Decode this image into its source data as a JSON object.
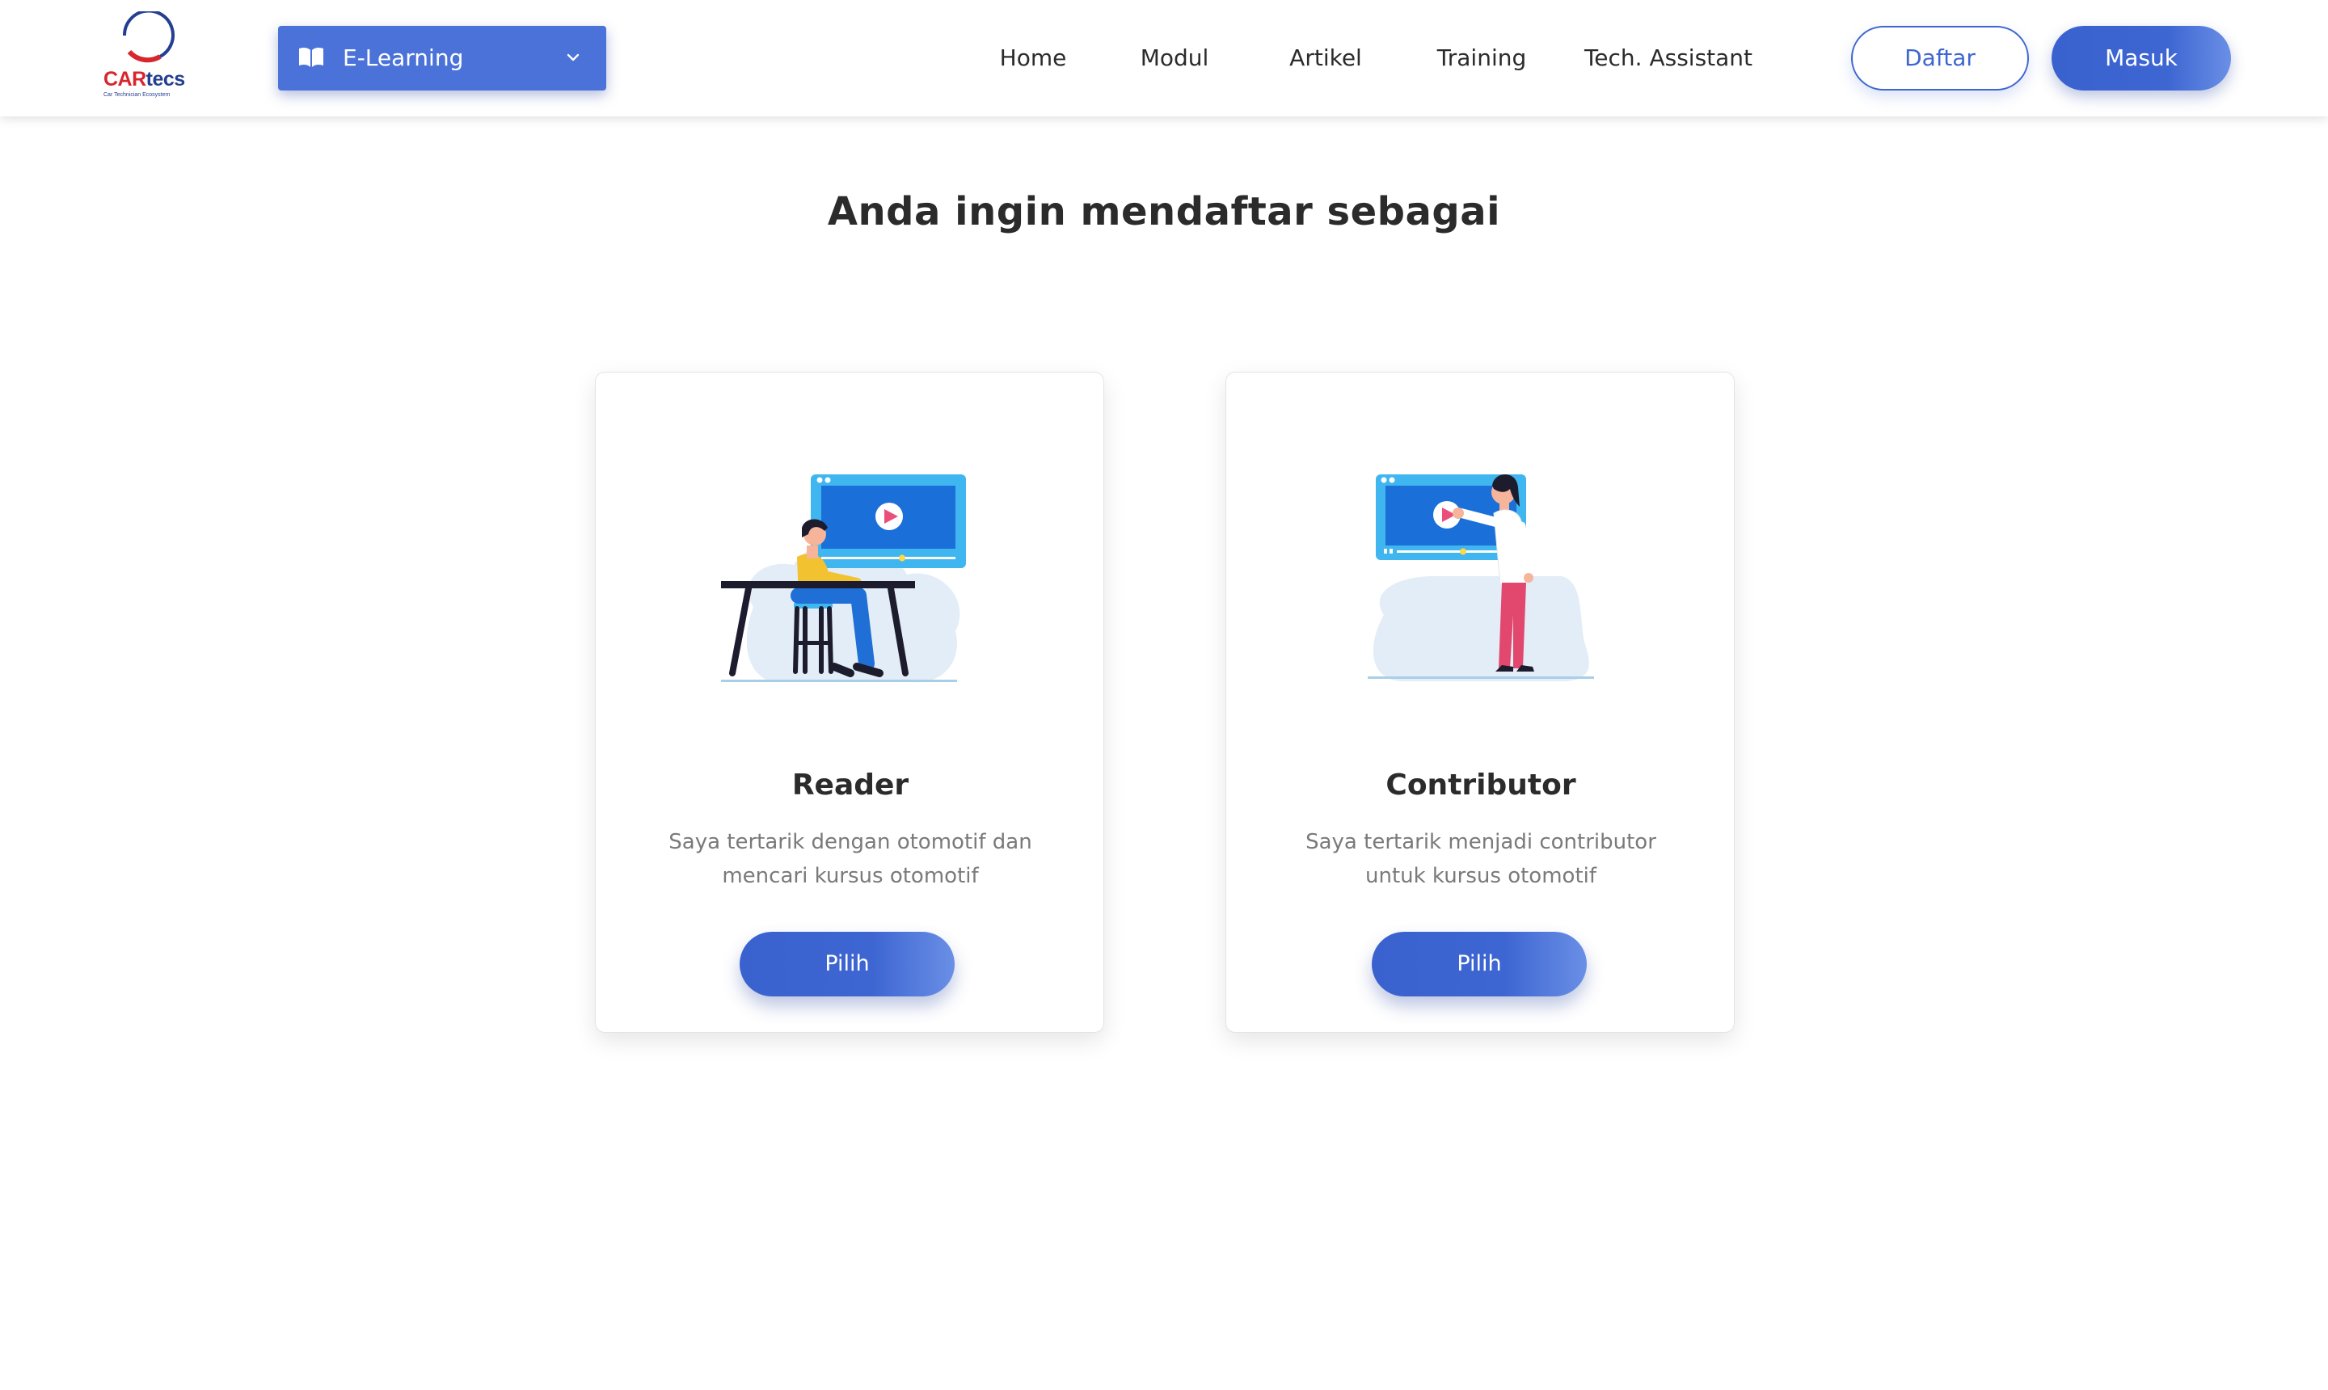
{
  "brand": {
    "name_part1": "CAR",
    "name_part2": "tecs",
    "tagline": "Car Technician Ecosystem",
    "colors": {
      "red": "#d7262d",
      "navy": "#243f91"
    }
  },
  "header": {
    "platform_select": {
      "value": "E-Learning",
      "icon": "book-open-icon"
    },
    "nav": [
      "Home",
      "Modul",
      "Artikel",
      "Training",
      "Tech. Assistant"
    ],
    "register_label": "Daftar",
    "login_label": "Masuk"
  },
  "main": {
    "title": "Anda ingin mendaftar sebagai",
    "cards": [
      {
        "title": "Reader",
        "description": "Saya tertarik dengan otomotif dan mencari kursus otomotif",
        "button_label": "Pilih",
        "illustration": "person-watching-video-at-desk"
      },
      {
        "title": "Contributor",
        "description": "Saya tertarik menjadi contributor untuk kursus otomotif",
        "button_label": "Pilih",
        "illustration": "person-presenting-video-screen"
      }
    ]
  },
  "colors": {
    "primary": "#3e66d2",
    "primary_light": "#6a8fe6",
    "select_bg": "#4a72d8",
    "text": "#2b2b2b",
    "muted": "#7a7a7a"
  }
}
